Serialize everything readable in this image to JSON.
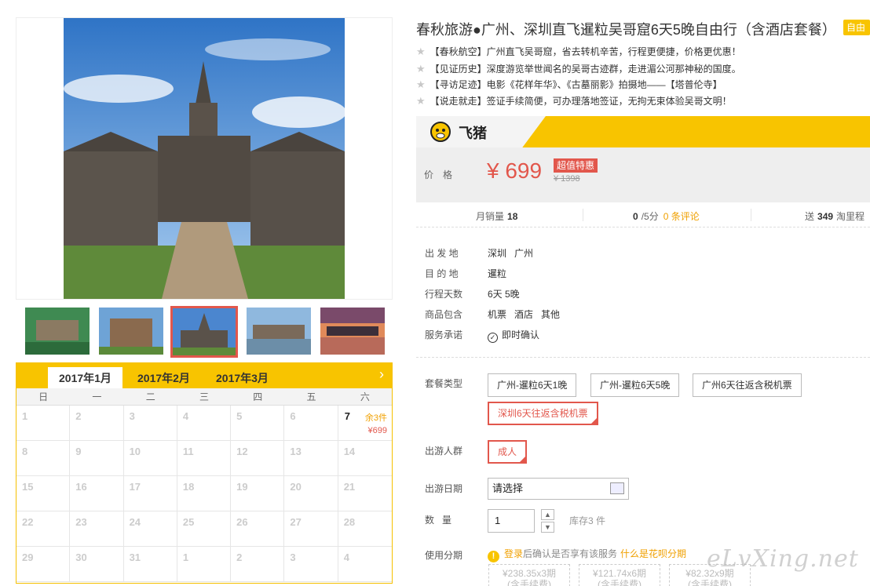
{
  "product": {
    "title": "春秋旅游●广州、深圳直飞暹粒吴哥窟6天5晚自由行（含酒店套餐）",
    "tag": "自由行",
    "features": [
      "【春秋航空】广州直飞吴哥窟，省去转机辛苦，行程更便捷，价格更优惠！",
      "【见证历史】深度游览举世闻名的吴哥古迹群，走进湄公河那神秘的国度。",
      "【寻访足迹】电影《花样年华》、《古墓丽影》拍摄地——【塔普伦寺】",
      "【说走就走】签证手续简便，可办理落地签证，无拘无束体验吴哥文明！"
    ]
  },
  "price_box": {
    "brand": "飞猪",
    "label": "价格",
    "price": "¥ 699",
    "badge": "超值特惠",
    "original_price": "¥ 1398"
  },
  "stats": {
    "monthly_sales_label": "月销量",
    "monthly_sales": "18",
    "rating": "0",
    "rating_suffix": "/5分",
    "reviews": "0 条评论",
    "points_prefix": "送",
    "points": "349",
    "points_suffix": "淘里程"
  },
  "info": [
    {
      "label": "出 发 地",
      "value": "深圳   广州"
    },
    {
      "label": "目 的 地",
      "value": "暹粒"
    },
    {
      "label": "行程天数",
      "value": "6天 5晚"
    },
    {
      "label": "商品包含",
      "value": "机票   酒店   其他"
    },
    {
      "label": "服务承诺",
      "value": "即时确认"
    }
  ],
  "package": {
    "label": "套餐类型",
    "options": [
      "广州-暹粒6天1晚",
      "广州-暹粒6天5晚",
      "广州6天往返含税机票",
      "深圳6天往返含税机票"
    ]
  },
  "crowd": {
    "label": "出游人群",
    "option": "成人"
  },
  "date": {
    "label": "出游日期",
    "value": "请选择"
  },
  "quantity": {
    "label": "数   量",
    "value": "1",
    "stock": "库存3 件"
  },
  "installment": {
    "label": "使用分期",
    "login": "登录",
    "text": "后确认是否享有该服务",
    "link": "什么是花呗分期",
    "plans": [
      {
        "amount": "¥238.35x3期",
        "note": "(含手续费)"
      },
      {
        "amount": "¥121.74x6期",
        "note": "(含手续费)"
      },
      {
        "amount": "¥82.32x9期",
        "note": "(含手续费)"
      }
    ]
  },
  "calendar": {
    "months": [
      "2017年1月",
      "2017年2月",
      "2017年3月"
    ],
    "weekdays": [
      "日",
      "一",
      "二",
      "三",
      "四",
      "五",
      "六"
    ],
    "days": [
      "1",
      "2",
      "3",
      "4",
      "5",
      "6",
      "7",
      "8",
      "9",
      "10",
      "11",
      "12",
      "13",
      "14",
      "15",
      "16",
      "17",
      "18",
      "19",
      "20",
      "21",
      "22",
      "23",
      "24",
      "25",
      "26",
      "27",
      "28",
      "29",
      "30",
      "31",
      "1",
      "2",
      "3",
      "4"
    ],
    "available": {
      "day": "7",
      "stock": "余3件",
      "price": "¥699"
    }
  },
  "watermark": "eLvXing.net",
  "icons": [
    "star-icon",
    "check-circle-icon",
    "calendar-icon",
    "chevron-right-icon",
    "warning-icon",
    "feizhu-logo-icon"
  ],
  "colors": {
    "accent": "#f8c400",
    "price": "#e2574c",
    "link": "#f0a000"
  }
}
